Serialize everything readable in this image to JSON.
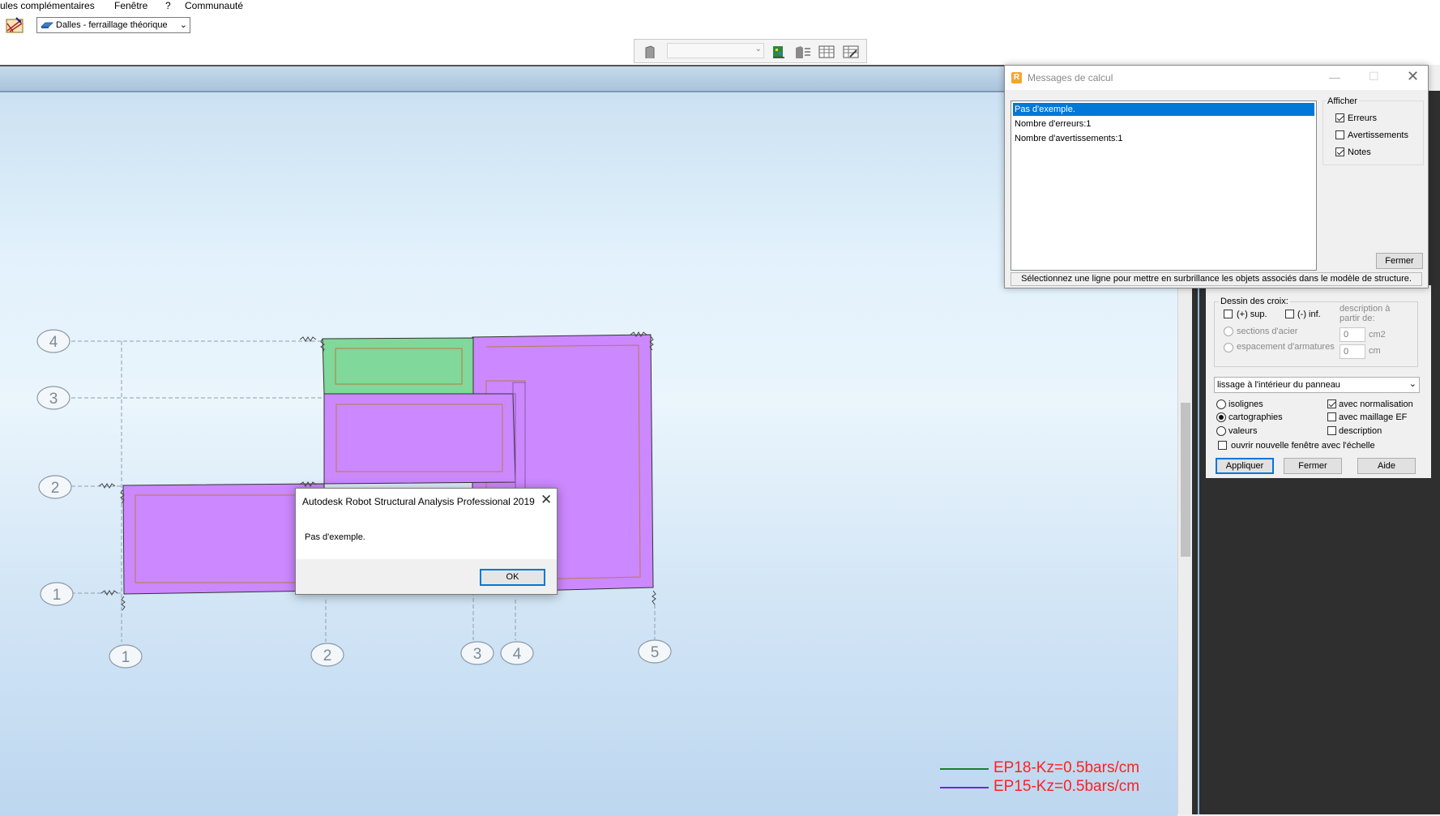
{
  "menu": {
    "items": [
      "ules complémentaires",
      "Fenêtre",
      "?",
      "Communauté"
    ]
  },
  "toolbar": {
    "layout_select_value": "Dalles - ferraillage théorique"
  },
  "view": {
    "grid_y_labels": [
      "4",
      "3",
      "2",
      "1"
    ],
    "grid_x_labels": [
      "1",
      "2",
      "3",
      "4",
      "5"
    ],
    "colors": {
      "slab_purple": "#cc88ff",
      "slab_green": "#80d89a",
      "background": "#e2f1fc"
    },
    "legend": [
      {
        "text": "EP18-Kz=0.5bars/cm",
        "color": "#1a7f2a"
      },
      {
        "text": "EP15-Kz=0.5bars/cm",
        "color": "#7b22d6"
      }
    ]
  },
  "messages_window": {
    "title": "Messages de calcul",
    "list": [
      {
        "text": "Pas d'exemple.",
        "selected": true
      },
      {
        "text": "Nombre d'erreurs:1",
        "selected": false
      },
      {
        "text": "Nombre d'avertissements:1",
        "selected": false
      }
    ],
    "show_group_title": "Afficher",
    "show_options": [
      {
        "label": "Erreurs",
        "checked": true
      },
      {
        "label": "Avertissements",
        "checked": false
      },
      {
        "label": "Notes",
        "checked": true
      }
    ],
    "close_label": "Fermer",
    "status": "Sélectionnez une ligne pour mettre en surbrillance les objets associés dans le modèle de structure."
  },
  "right_panel": {
    "cross_group_title": "Dessin des croix:",
    "sup_label": "(+) sup.",
    "inf_label": "(-) inf.",
    "description_from": "description à partir de:",
    "sections_label": "sections d'acier",
    "spacing_label": "espacement d'armatures",
    "sections_value": "0",
    "spacing_value": "0",
    "sections_unit": "cm2",
    "spacing_unit": "cm",
    "smoothing_value": "lissage à l'intérieur du panneau",
    "mode_options": [
      {
        "label": "isolignes",
        "selected": false
      },
      {
        "label": "cartographies",
        "selected": true
      },
      {
        "label": "valeurs",
        "selected": false
      }
    ],
    "normalization_label": "avec normalisation",
    "normalization_checked": true,
    "mesh_label": "avec maillage EF",
    "mesh_checked": false,
    "description_label": "description",
    "description_checked": false,
    "new_window_label": "ouvrir nouvelle fenêtre avec l'échelle",
    "new_window_checked": false,
    "apply_label": "Appliquer",
    "close_label": "Fermer",
    "help_label": "Aide"
  },
  "dialog": {
    "title": "Autodesk Robot Structural Analysis Professional 2019",
    "message": "Pas d'exemple.",
    "ok_label": "OK"
  }
}
